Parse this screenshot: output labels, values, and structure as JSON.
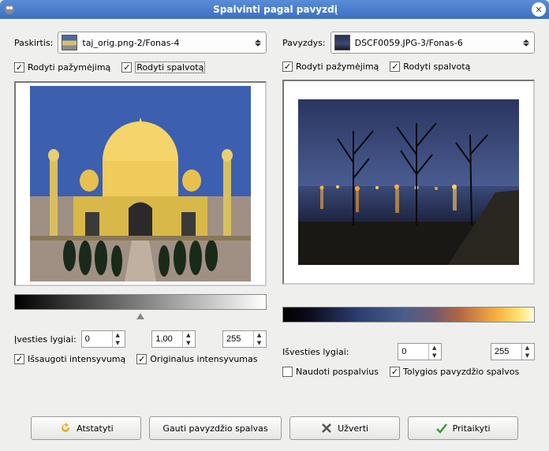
{
  "window": {
    "title": "Spalvinti pagal pavyzdį"
  },
  "dest": {
    "label": "Paskirtis:",
    "value": "taj_orig.png-2/Fonas-4",
    "show_selection_label": "Rodyti pažymėjimą",
    "show_selection_checked": true,
    "show_color_label": "Rodyti spalvotą",
    "show_color_checked": true,
    "levels_label": "Įvesties lygiai:",
    "low": "0",
    "gamma": "1,00",
    "high": "255",
    "keep_intensity_label": "Išsaugoti intensyvumą",
    "keep_intensity_checked": true,
    "orig_intensity_label": "Originalus intensyvumas",
    "orig_intensity_checked": true
  },
  "sample": {
    "label": "Pavyzdys:",
    "value": "DSCF0059.JPG-3/Fonas-6",
    "show_selection_label": "Rodyti pažymėjimą",
    "show_selection_checked": true,
    "show_color_label": "Rodyti spalvotą",
    "show_color_checked": true,
    "levels_label": "Išvesties lygiai:",
    "low": "0",
    "high": "255",
    "use_subcolors_label": "Naudoti pospalvius",
    "use_subcolors_checked": false,
    "smooth_label": "Tolygios pavyzdžio spalvos",
    "smooth_checked": true
  },
  "buttons": {
    "reset": "Atstatyti",
    "get": "Gauti pavyzdžio spalvas",
    "close": "Užverti",
    "apply": "Pritaikyti"
  }
}
